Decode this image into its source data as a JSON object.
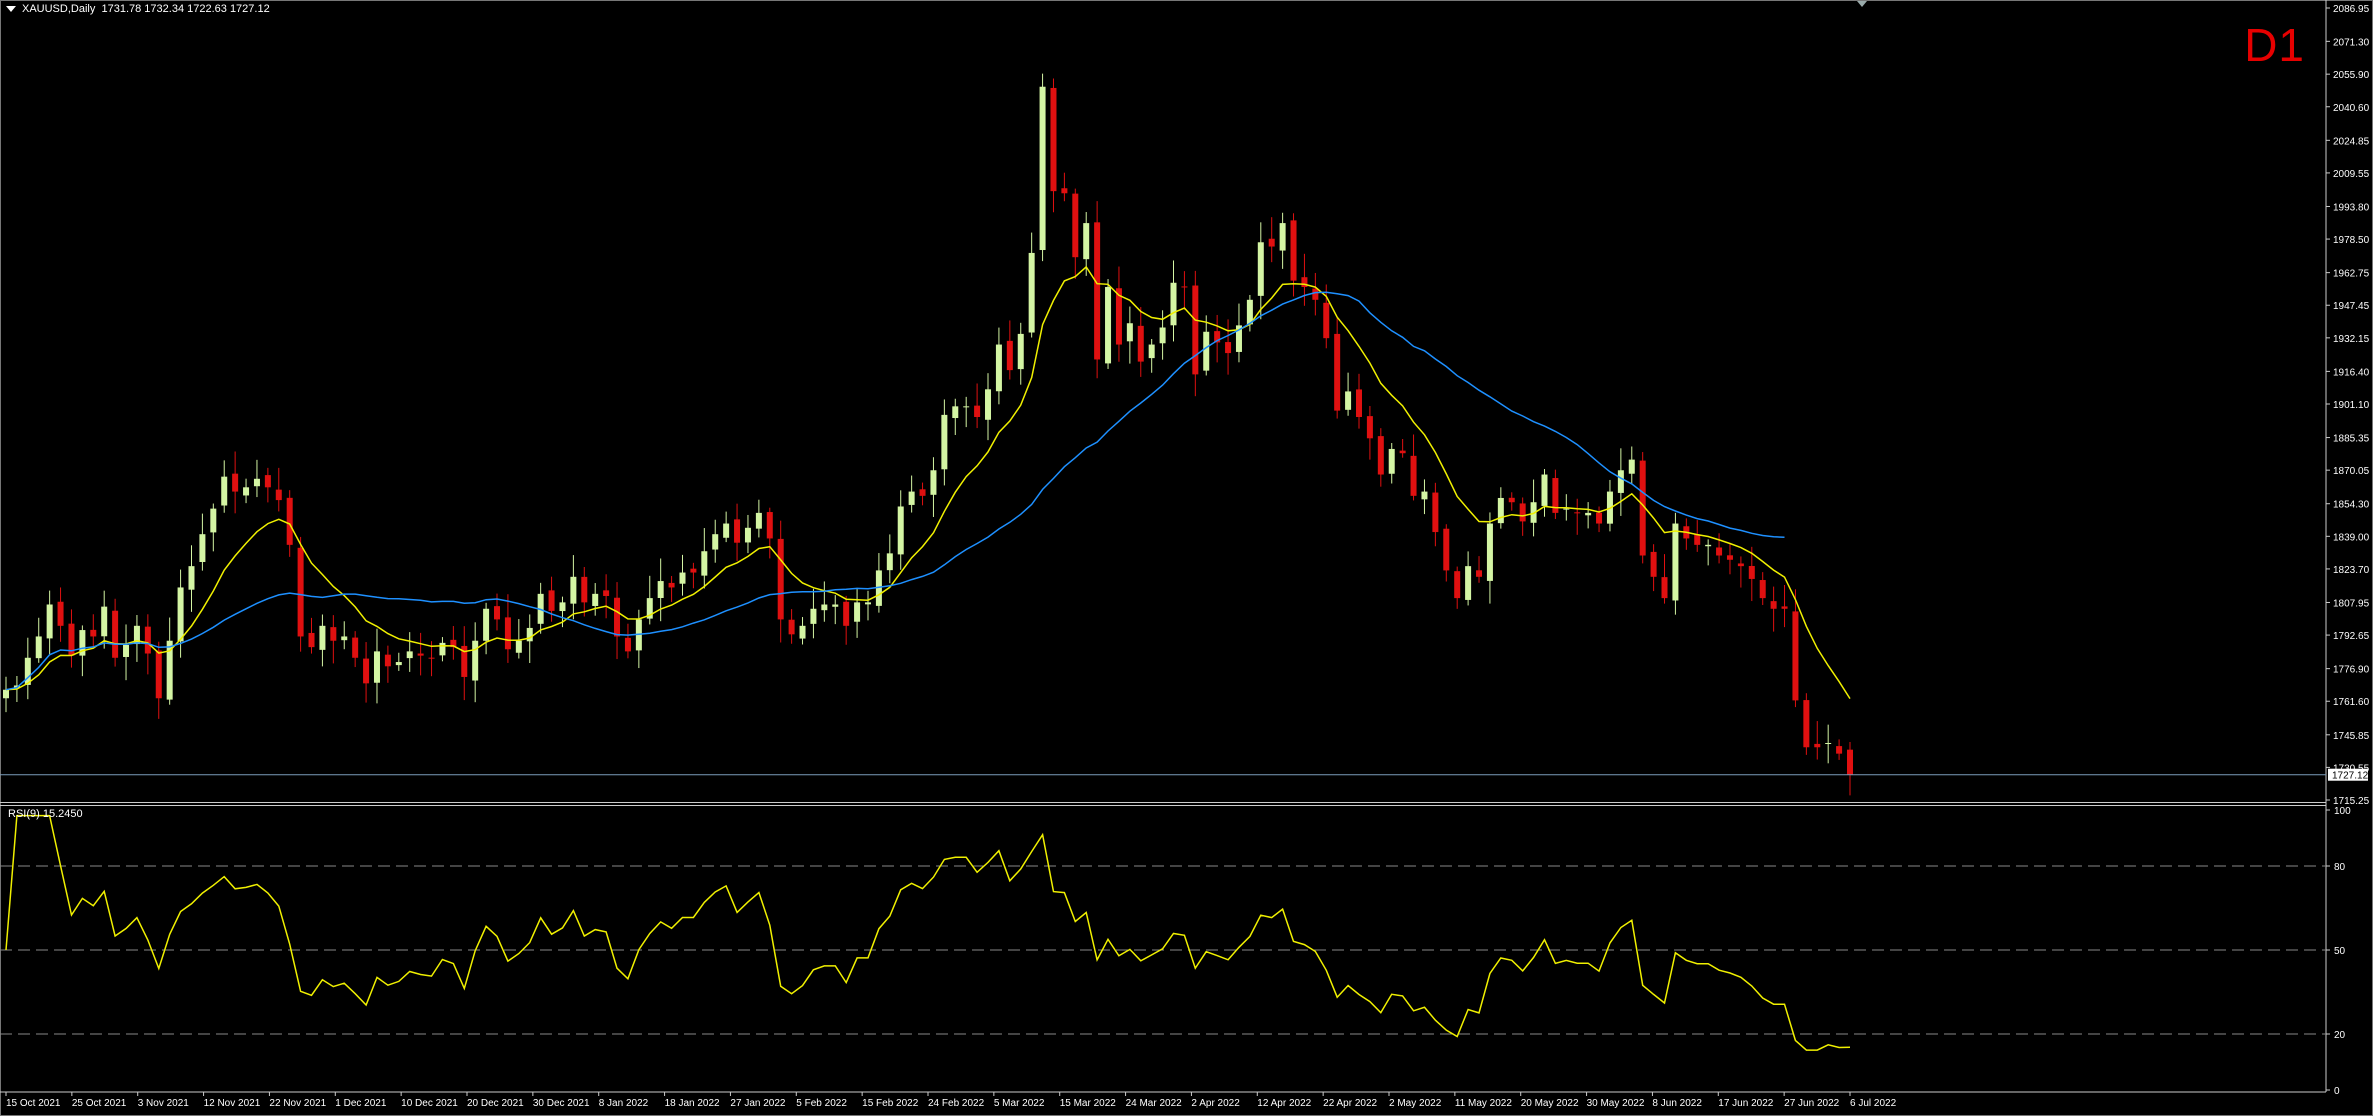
{
  "header": {
    "symbol_line": "XAUUSD,Daily",
    "ohlc": "1731.78 1732.34 1722.63 1727.12",
    "timeframe_label": "D1"
  },
  "rsi_panel": {
    "label": "RSI(9) 15.2450",
    "levels": [
      80,
      50,
      20
    ],
    "axis_ticks": [
      "100",
      "80",
      "50",
      "20",
      "0"
    ]
  },
  "colors": {
    "background": "#000000",
    "bull": "#d4f5a4",
    "bear": "#e01010",
    "fast_ma": "#f0f000",
    "slow_ma": "#1e90ff",
    "rsi": "#f0f000",
    "price_line": "#7a9cba",
    "grid_text": "#ffffff",
    "timeframe_label": "#e60000"
  },
  "chart_data": {
    "type": "candlestick",
    "price_axis": {
      "ylim": [
        1715.25,
        2086.95
      ],
      "tick_labels": [
        "2086.95",
        "2071.30",
        "2055.90",
        "2040.60",
        "2024.85",
        "2009.55",
        "1993.80",
        "1978.50",
        "1962.75",
        "1947.45",
        "1932.15",
        "1916.40",
        "1901.10",
        "1885.35",
        "1870.05",
        "1854.30",
        "1839.00",
        "1823.70",
        "1807.95",
        "1792.65",
        "1776.90",
        "1761.60",
        "1745.85",
        "1730.55",
        "1715.25"
      ]
    },
    "current_price": "1727.12",
    "x_axis": {
      "tick_labels": [
        "15 Oct 2021",
        "25 Oct 2021",
        "3 Nov 2021",
        "12 Nov 2021",
        "22 Nov 2021",
        "1 Dec 2021",
        "10 Dec 2021",
        "20 Dec 2021",
        "30 Dec 2021",
        "8 Jan 2022",
        "18 Jan 2022",
        "27 Jan 2022",
        "5 Feb 2022",
        "15 Feb 2022",
        "24 Feb 2022",
        "5 Mar 2022",
        "15 Mar 2022",
        "24 Mar 2022",
        "2 Apr 2022",
        "12 Apr 2022",
        "22 Apr 2022",
        "2 May 2022",
        "11 May 2022",
        "20 May 2022",
        "30 May 2022",
        "8 Jun 2022",
        "17 Jun 2022",
        "27 Jun 2022",
        "6 Jul 2022"
      ]
    },
    "close_series": [
      1767,
      1769,
      1782,
      1792,
      1807,
      1797,
      1783,
      1795,
      1792,
      1806,
      1782,
      1788,
      1797,
      1784,
      1763,
      1790,
      1815,
      1825,
      1840,
      1852,
      1867,
      1860,
      1862,
      1866,
      1862,
      1856,
      1835,
      1792,
      1787,
      1797,
      1790,
      1792,
      1782,
      1770,
      1785,
      1778,
      1780,
      1785,
      1783,
      1782,
      1789,
      1787,
      1773,
      1790,
      1805,
      1800,
      1786,
      1790,
      1796,
      1812,
      1804,
      1808,
      1820,
      1808,
      1812,
      1811,
      1792,
      1785,
      1800,
      1810,
      1818,
      1815,
      1822,
      1822,
      1832,
      1840,
      1845,
      1836,
      1843,
      1850,
      1838,
      1800,
      1793,
      1797,
      1805,
      1807,
      1807,
      1797,
      1808,
      1808,
      1823,
      1831,
      1853,
      1860,
      1858,
      1870,
      1896,
      1900,
      1900,
      1895,
      1908,
      1929,
      1917,
      1934,
      1972,
      2050,
      2001,
      2000,
      1970,
      1986,
      1922,
      1956,
      1929,
      1939,
      1921,
      1929,
      1937,
      1958,
      1956,
      1915,
      1935,
      1930,
      1925,
      1938,
      1950,
      1977,
      1975,
      1986,
      1959,
      1956,
      1950,
      1932,
      1898,
      1907,
      1895,
      1885,
      1868,
      1880,
      1878,
      1858,
      1860,
      1841,
      1823,
      1810,
      1825,
      1820,
      1845,
      1857,
      1855,
      1846,
      1855,
      1868,
      1850,
      1852,
      1850,
      1850,
      1845,
      1860,
      1870,
      1875,
      1830,
      1820,
      1810,
      1845,
      1838,
      1835,
      1835,
      1830,
      1828,
      1825,
      1819,
      1810,
      1805,
      1805,
      1762,
      1740,
      1740,
      1742,
      1737,
      1727
    ],
    "fast_ma": {
      "name": "",
      "color": "#f0f000"
    },
    "slow_ma": {
      "name": "",
      "color": "#1e90ff"
    },
    "rsi": {
      "period": 9,
      "last_value": 15.245,
      "ylim": [
        0,
        100
      ]
    }
  }
}
